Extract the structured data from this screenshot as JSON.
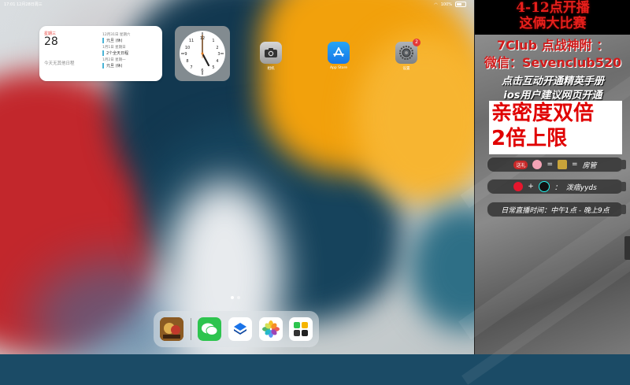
{
  "status_bar": {
    "time_date": "17:01  12月28日周三",
    "battery": "100%"
  },
  "calendar_widget": {
    "weekday": "星期三",
    "day": "28",
    "empty_text": "今天无其他日程",
    "events": [
      {
        "date": "12月31日 星期六",
        "title": "元旦 (休)"
      },
      {
        "date": "1月1日 星期日",
        "title": "2个全天日程"
      },
      {
        "date": "1月2日 星期一",
        "title": "元旦 (休)"
      }
    ]
  },
  "apps": {
    "camera_label": "相机",
    "appstore_label": "App Store",
    "settings_label": "设置",
    "settings_badge": "2"
  },
  "overlay": {
    "banner_line1": "4-12点开播",
    "banner_line2": "这俩大比赛",
    "club": "7Club 点战神附 ：",
    "wechat": "微信：Sevenclub520",
    "manual": "点击互动开通精英手册",
    "ios": "ios用户建议网页开通",
    "intimacy_line1": "亲密度双倍",
    "intimacy_line2": "2倍上限",
    "pill1_badge": "送礼",
    "pill1_eq1": "=",
    "pill1_eq2": "=",
    "pill1_text": "房管",
    "pill2_plus": "+",
    "pill2_colon": "：",
    "pill2_text": "泼痞yyds",
    "pill3_text": "日常直播时间：中午1点 - 晚上9点"
  },
  "colors": {
    "accent_red": "#e8201c",
    "calendar_red": "#e8403a",
    "event_bar": "#4ab4d6"
  }
}
